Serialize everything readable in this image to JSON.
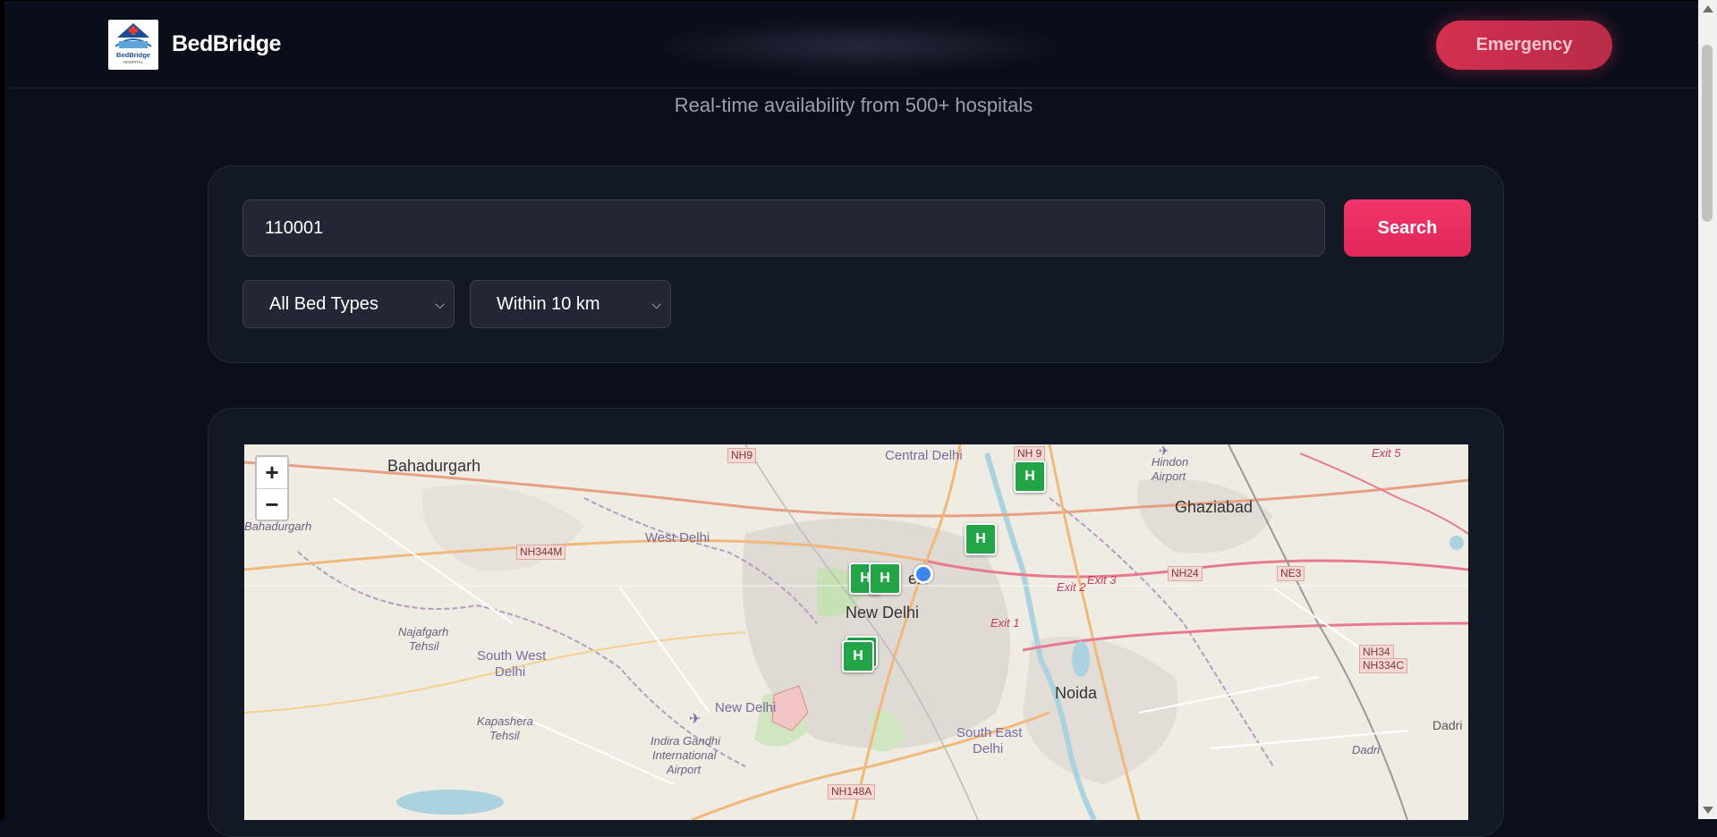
{
  "header": {
    "brand": "BedBridge",
    "logo_text": "BedBridge",
    "logo_subtext": "HOSPITAL",
    "emergency_label": "Emergency"
  },
  "subtitle": "Real-time availability from 500+ hospitals",
  "search": {
    "value": "110001",
    "button_label": "Search",
    "bed_type_selected": "All Bed Types",
    "distance_selected": "Within 10 km"
  },
  "map": {
    "zoom_in": "+",
    "zoom_out": "−",
    "marker_label": "H",
    "places": {
      "bahadurgarh": "Bahadurgarh",
      "bahadurgarh_small": "Bahadurgarh",
      "central_delhi": "Central Delhi",
      "west_delhi": "West Delhi",
      "new_delhi": "New Delhi",
      "new_delhi_2": "New Delhi",
      "south_west_delhi_1": "South West",
      "south_west_delhi_2": "Delhi",
      "najafgarh_1": "Najafgarh",
      "najafgarh_2": "Tehsil",
      "kapashera_1": "Kapashera",
      "kapashera_2": "Tehsil",
      "airport_1": "Indira Gandhi",
      "airport_2": "International",
      "airport_3": "Airport",
      "ghaziabad": "Ghaziabad",
      "hindon_1": "Hindon",
      "hindon_2": "Airport",
      "noida": "Noida",
      "south_east_1": "South East",
      "south_east_2": "Delhi",
      "dadri": "Dadri",
      "dadri_2": "Dadri",
      "ell": "elli"
    },
    "shields": {
      "nh9": "NH9",
      "nh9b": "NH 9",
      "nh344m": "NH344M",
      "nh24": "NH24",
      "ne3": "NE3",
      "nh34": "NH34",
      "nh334c": "NH334C",
      "nh148a": "NH148A"
    },
    "exits": {
      "exit1": "Exit 1",
      "exit2": "Exit 2",
      "exit3": "Exit 3",
      "exit5": "Exit 5"
    }
  }
}
